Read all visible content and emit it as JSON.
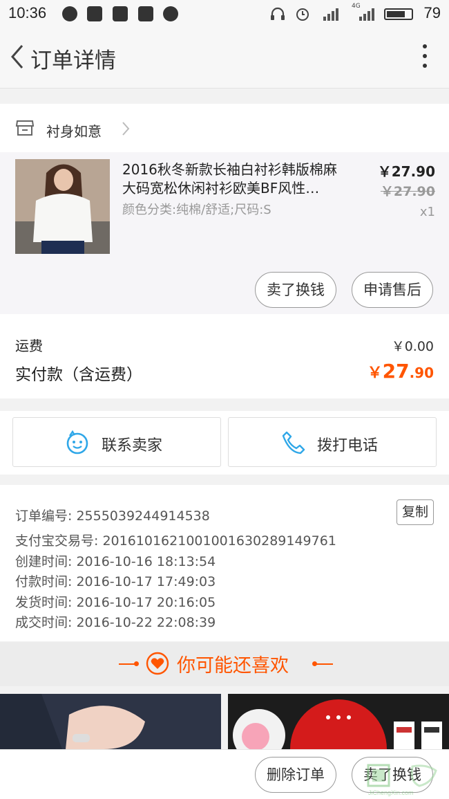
{
  "status_bar": {
    "time": "10:36",
    "battery": "79",
    "network": "4G",
    "icons": [
      "wechat-icon",
      "message-icon",
      "mail-icon",
      "news-icon",
      "browser-icon",
      "headset-icon",
      "alarm-icon",
      "signal-icon",
      "battery-icon"
    ]
  },
  "header": {
    "title": "订单详情"
  },
  "store": {
    "name": "衬身如意"
  },
  "item": {
    "title": "2016秋冬新款长袖白衬衫韩版棉麻大码宽松休闲衬衫欧美BF风性…",
    "attributes": "颜色分类:纯棉/舒适;尺码:S",
    "price": "￥27.90",
    "original_price": "￥27.90",
    "quantity": "x1",
    "buttons": {
      "sell": "卖了换钱",
      "after_sale": "申请售后"
    }
  },
  "totals": {
    "shipping_label": "运费",
    "shipping_value": "￥0.00",
    "paid_label": "实付款（含运费）",
    "paid_symbol": "￥",
    "paid_int": "27",
    "paid_dec": ".90"
  },
  "contact": {
    "seller": "联系卖家",
    "phone": "拨打电话"
  },
  "order_info": {
    "order_no": "订单编号: 2555039244914538",
    "copy": "复制",
    "alipay_no": "支付宝交易号: 2016101621001001630289149761",
    "created": "创建时间: 2016-10-16 18:13:54",
    "paid": "付款时间: 2016-10-17 17:49:03",
    "shipped": "发货时间: 2016-10-17 20:16:05",
    "completed": "成交时间: 2016-10-22 22:08:39"
  },
  "recommend": {
    "title": "你可能还喜欢"
  },
  "bottom": {
    "delete": "删除订单",
    "sell": "卖了换钱"
  },
  "watermark": {
    "text": "JiChengXin.com"
  },
  "colors": {
    "accent": "#ff5500",
    "contact_icon": "#2fa7e8"
  }
}
